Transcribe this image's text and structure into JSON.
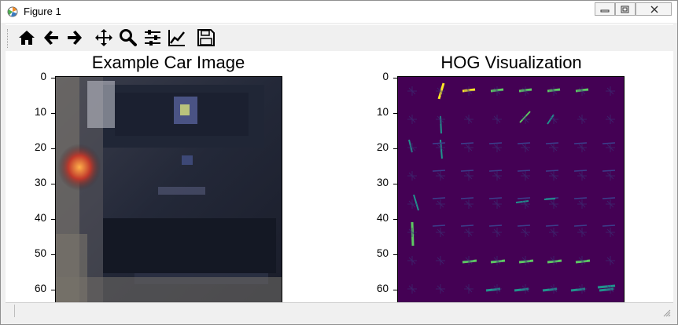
{
  "window": {
    "title": "Figure 1"
  },
  "toolbar": {
    "buttons": [
      "home",
      "back",
      "forward",
      "pan",
      "zoom",
      "configure-subplots",
      "edit-axes",
      "save"
    ]
  },
  "figure": {
    "left_axes": {
      "title": "Example Car Image",
      "yticks": [
        "0",
        "10",
        "20",
        "30",
        "40",
        "50",
        "60"
      ]
    },
    "right_axes": {
      "title": "HOG Visualization",
      "yticks": [
        "0",
        "10",
        "20",
        "30",
        "40",
        "50",
        "60"
      ]
    }
  },
  "colors": {
    "hog_background": "#440154",
    "hog_teal": "#21918c",
    "hog_green": "#5ec962",
    "hog_yellow": "#fde725"
  }
}
